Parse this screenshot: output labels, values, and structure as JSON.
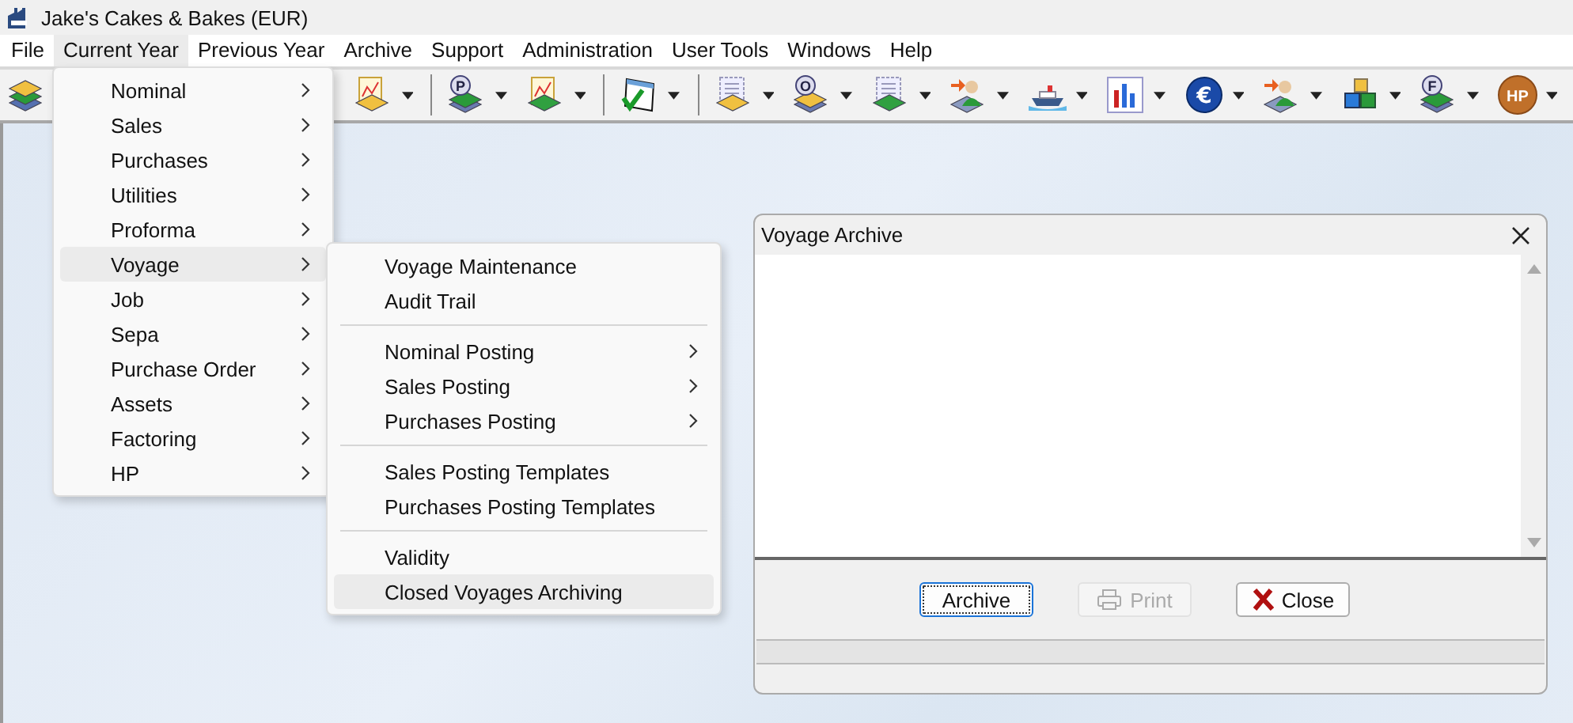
{
  "window": {
    "title": "Jake's Cakes & Bakes (EUR)"
  },
  "menu_bar": [
    {
      "label": "File",
      "selected": false
    },
    {
      "label": "Current Year",
      "selected": true
    },
    {
      "label": "Previous Year",
      "selected": false
    },
    {
      "label": "Archive",
      "selected": false
    },
    {
      "label": "Support",
      "selected": false
    },
    {
      "label": "Administration",
      "selected": false
    },
    {
      "label": "User Tools",
      "selected": false
    },
    {
      "label": "Windows",
      "selected": false
    },
    {
      "label": "Help",
      "selected": false
    }
  ],
  "toolbar": [
    {
      "kind": "layers"
    },
    {
      "kind": "spacer"
    },
    {
      "kind": "doc-chart",
      "caret": true
    },
    {
      "kind": "separator"
    },
    {
      "kind": "badge-layers",
      "badge": "P",
      "caret": true
    },
    {
      "kind": "doc-chart-green",
      "caret": true
    },
    {
      "kind": "separator"
    },
    {
      "kind": "check-window",
      "caret": true
    },
    {
      "kind": "separator"
    },
    {
      "kind": "doc-layers",
      "caret": true
    },
    {
      "kind": "badge-layers",
      "badge": "O",
      "caret": true
    },
    {
      "kind": "doc-layers-green",
      "caret": true
    },
    {
      "kind": "person-arrow",
      "caret": true
    },
    {
      "kind": "ship",
      "caret": true
    },
    {
      "kind": "bar-chart",
      "caret": true
    },
    {
      "kind": "coin",
      "badge": "€",
      "caret": true
    },
    {
      "kind": "person-arrow",
      "caret": true
    },
    {
      "kind": "cubes",
      "caret": true
    },
    {
      "kind": "badge-layers",
      "badge": "F",
      "caret": true
    },
    {
      "kind": "coin-brown",
      "badge": "HP",
      "caret": true
    }
  ],
  "menu": {
    "items": [
      {
        "label": "Nominal",
        "submenu": true,
        "selected": false
      },
      {
        "label": "Sales",
        "submenu": true,
        "selected": false
      },
      {
        "label": "Purchases",
        "submenu": true,
        "selected": false
      },
      {
        "label": "Utilities",
        "submenu": true,
        "selected": false
      },
      {
        "label": "Proforma",
        "submenu": true,
        "selected": false
      },
      {
        "label": "Voyage",
        "submenu": true,
        "selected": true
      },
      {
        "label": "Job",
        "submenu": true,
        "selected": false
      },
      {
        "label": "Sepa",
        "submenu": true,
        "selected": false
      },
      {
        "label": "Purchase Order",
        "submenu": true,
        "selected": false
      },
      {
        "label": "Assets",
        "submenu": true,
        "selected": false
      },
      {
        "label": "Factoring",
        "submenu": true,
        "selected": false
      },
      {
        "label": "HP",
        "submenu": true,
        "selected": false
      }
    ]
  },
  "submenu": {
    "groups": [
      [
        {
          "label": "Voyage Maintenance",
          "submenu": false,
          "selected": false
        },
        {
          "label": "Audit Trail",
          "submenu": false,
          "selected": false
        }
      ],
      [
        {
          "label": "Nominal Posting",
          "submenu": true,
          "selected": false
        },
        {
          "label": "Sales Posting",
          "submenu": true,
          "selected": false
        },
        {
          "label": "Purchases Posting",
          "submenu": true,
          "selected": false
        }
      ],
      [
        {
          "label": "Sales Posting Templates",
          "submenu": false,
          "selected": false
        },
        {
          "label": "Purchases Posting Templates",
          "submenu": false,
          "selected": false
        }
      ],
      [
        {
          "label": "Validity",
          "submenu": false,
          "selected": false
        },
        {
          "label": "Closed Voyages Archiving",
          "submenu": false,
          "selected": true
        }
      ]
    ]
  },
  "dialog": {
    "title": "Voyage Archive",
    "buttons": [
      {
        "label": "Archive",
        "kind": "archive",
        "focused": true,
        "disabled": false
      },
      {
        "label": "Print",
        "kind": "print",
        "focused": false,
        "disabled": true
      },
      {
        "label": "Close",
        "kind": "close",
        "focused": false,
        "disabled": false
      }
    ]
  }
}
